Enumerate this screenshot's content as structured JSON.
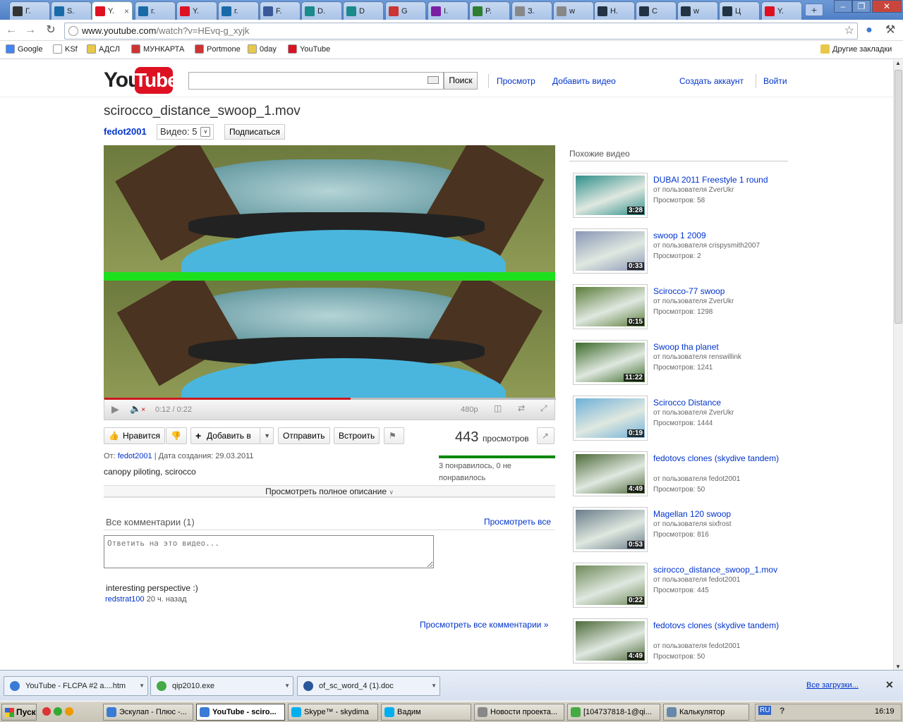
{
  "browser": {
    "tabs": [
      {
        "label": "Г.",
        "color": "#333"
      },
      {
        "label": "S.",
        "color": "#1a6aa8"
      },
      {
        "label": "Y.",
        "color": "#d12",
        "active": true
      },
      {
        "label": "г.",
        "color": "#1a6aa8"
      },
      {
        "label": "Y.",
        "color": "#d12"
      },
      {
        "label": "г.",
        "color": "#1a6aa8"
      },
      {
        "label": "F.",
        "color": "#3b5998"
      },
      {
        "label": "D.",
        "color": "#1a8a8a"
      },
      {
        "label": "D",
        "color": "#1a8a8a"
      },
      {
        "label": "G",
        "color": "#c33"
      },
      {
        "label": "I.",
        "color": "#7b1fa2"
      },
      {
        "label": "P.",
        "color": "#2e7d32"
      },
      {
        "label": "З.",
        "color": "#888"
      },
      {
        "label": "w",
        "color": "#888"
      },
      {
        "label": "Н.",
        "color": "#234"
      },
      {
        "label": "С",
        "color": "#234"
      },
      {
        "label": "w",
        "color": "#234"
      },
      {
        "label": "Ц",
        "color": "#234"
      },
      {
        "label": "Y.",
        "color": "#d12"
      }
    ],
    "new_tab": "+",
    "url_host": "www.youtube.com",
    "url_path": "/watch?v=HEvq-g_xyjk",
    "bookmarks": [
      {
        "label": "Google",
        "color": "#4285f4"
      },
      {
        "label": "KSf",
        "color": "#fff"
      },
      {
        "label": "АДСЛ",
        "color": "#e8c84a"
      },
      {
        "label": "МУНКАРТА",
        "color": "#c33"
      },
      {
        "label": "Portmone",
        "color": "#c33"
      },
      {
        "label": "0day",
        "color": "#e8c84a"
      },
      {
        "label": "YouTube",
        "color": "#d12"
      }
    ],
    "other_bookmarks": "Другие закладки"
  },
  "header": {
    "logo_you": "You",
    "logo_tube": "Tube",
    "search_button": "Поиск",
    "browse": "Просмотр",
    "upload": "Добавить видео",
    "create_account": "Создать аккаунт",
    "sign_in": "Войти"
  },
  "video": {
    "title": "scirocco_distance_swoop_1.mov",
    "owner": "fedot2001",
    "video_count": "Видео: 5",
    "subscribe": "Подписаться",
    "time": "0:12 / 0:22",
    "played_fraction": 0.545,
    "loaded_fraction": 0.41,
    "quality": "480p",
    "like": "Нравится",
    "add_to": "Добавить в",
    "share": "Отправить",
    "embed": "Встроить",
    "views_count": "443",
    "views_label": "просмотров",
    "likes_text": "3 понравилось, 0 не понравилось",
    "from_label": "От:",
    "uploader": "fedot2001",
    "created": "| Дата создания: 29.03.2011",
    "description": "canopy piloting, scirocco",
    "show_more": "Просмотреть полное описание"
  },
  "comments": {
    "header": "Все комментарии (1)",
    "view_all": "Просмотреть все",
    "placeholder": "Ответить на это видео...",
    "items": [
      {
        "text": "interesting perspective :)",
        "user": "redstrat100",
        "time": "20 ч. назад"
      }
    ],
    "all_comments": "Просмотреть все комментарии »"
  },
  "related": {
    "header": "Похожие видео",
    "items": [
      {
        "title": "DUBAI 2011 Freestyle 1 round",
        "by": "от пользователя ZverUkr",
        "views": "Просмотров: 58",
        "duration": "3:28",
        "tone": "#2f8f8a"
      },
      {
        "title": "swoop 1 2009",
        "by": "от пользователя crispysmith2007",
        "views": "Просмотров: 2",
        "duration": "0:33",
        "tone": "#8a97b6"
      },
      {
        "title": "Scirocco-77 swoop",
        "by": "от пользователя ZverUkr",
        "views": "Просмотров: 1298",
        "duration": "0:15",
        "tone": "#5b7d3a"
      },
      {
        "title": "Swoop tha planet",
        "by": "от пользователя renswillink",
        "views": "Просмотров: 1241",
        "duration": "11:22",
        "tone": "#3d6b2a"
      },
      {
        "title": "Scirocco Distance",
        "by": "от пользователя ZverUkr",
        "views": "Просмотров: 1444",
        "duration": "0:19",
        "tone": "#6fb0d8"
      },
      {
        "title": "fedotovs clones (skydive tandem)",
        "by": "от пользователя fedot2001",
        "views": "Просмотров: 50",
        "duration": "4:49",
        "tone": "#4f6b3a"
      },
      {
        "title": "Magellan 120 swoop",
        "by": "от пользователя sixfrost",
        "views": "Просмотров: 816",
        "duration": "0:53",
        "tone": "#6b7d8a"
      },
      {
        "title": "scirocco_distance_swoop_1.mov",
        "by": "от пользователя fedot2001",
        "views": "Просмотров: 445",
        "duration": "0:22",
        "tone": "#6f8a5a"
      },
      {
        "title": "fedotovs clones (skydive tandem)",
        "by": "от пользователя fedot2001",
        "views": "Просмотров: 50",
        "duration": "4:49",
        "tone": "#4f6b3a"
      }
    ]
  },
  "downloads": {
    "items": [
      {
        "label": "YouTube - FLCPA #2 a....htm",
        "color": "#3a7bd5"
      },
      {
        "label": "qip2010.exe",
        "color": "#4a4"
      },
      {
        "label": "of_sc_word_4 (1).doc",
        "color": "#2b579a"
      }
    ],
    "all": "Все загрузки..."
  },
  "taskbar": {
    "start": "Пуск",
    "tasks": [
      {
        "label": "Эскулап - Плюс -...",
        "color": "#3a7bd5"
      },
      {
        "label": "YouTube - sciro...",
        "color": "#3a7bd5",
        "active": true
      },
      {
        "label": "Skype™ - skydima",
        "color": "#00aff0"
      },
      {
        "label": "Вадим",
        "color": "#00aff0"
      },
      {
        "label": "Новости проекта...",
        "color": "#888"
      },
      {
        "label": "[104737818-1@qi...",
        "color": "#4a4"
      },
      {
        "label": "Калькулятор",
        "color": "#68a"
      }
    ],
    "lang": "RU",
    "clock": "16:19"
  }
}
